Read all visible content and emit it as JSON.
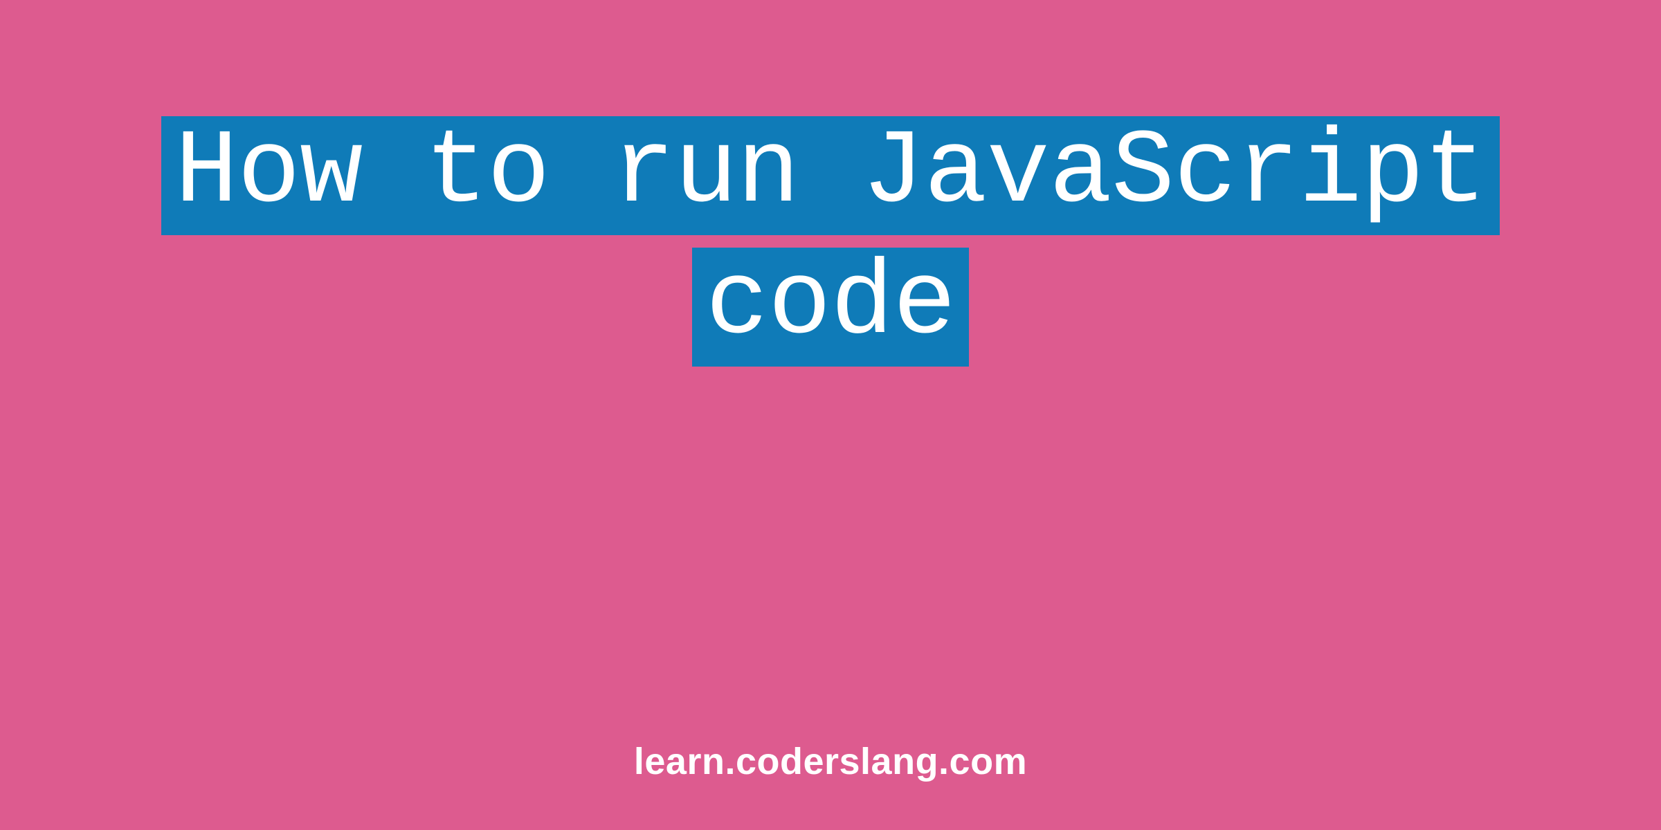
{
  "title": {
    "line1": "How to run JavaScript",
    "line2": "code"
  },
  "site_url": "learn.coderslang.com",
  "colors": {
    "background": "#dd5b8f",
    "highlight": "#0f7bb8",
    "text": "#ffffff"
  }
}
